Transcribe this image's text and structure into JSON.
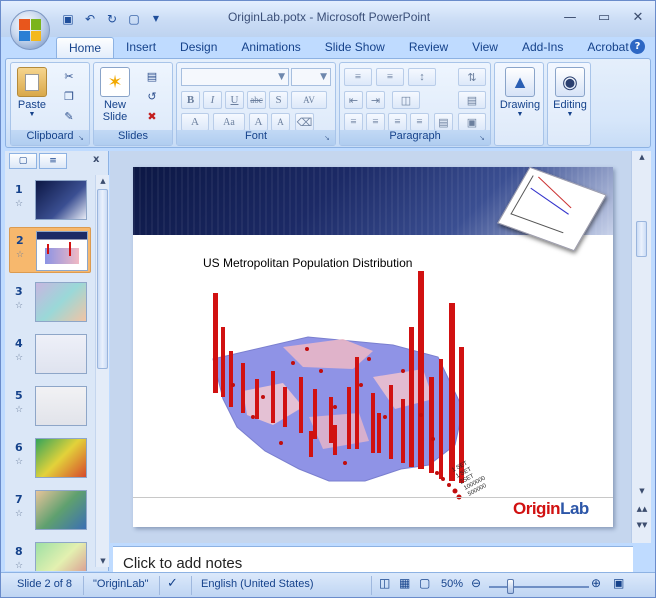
{
  "window": {
    "title": "OriginLab.potx - Microsoft PowerPoint"
  },
  "qat": {
    "items": [
      "save-icon",
      "undo-icon",
      "redo-icon",
      "slide-icon",
      "customize-icon"
    ]
  },
  "tabs": [
    "Home",
    "Insert",
    "Design",
    "Animations",
    "Slide Show",
    "Review",
    "View",
    "Add-Ins",
    "Acrobat"
  ],
  "ribbon": {
    "clipboard": {
      "label": "Clipboard",
      "paste": "Paste"
    },
    "slides": {
      "label": "Slides",
      "new_slide": "New",
      "new_slide2": "Slide"
    },
    "font": {
      "label": "Font"
    },
    "paragraph": {
      "label": "Paragraph"
    },
    "drawing": {
      "label": "Drawing"
    },
    "editing": {
      "label": "Editing"
    }
  },
  "slidepane": {
    "thumbnails": [
      {
        "num": "1"
      },
      {
        "num": "2"
      },
      {
        "num": "3"
      },
      {
        "num": "4"
      },
      {
        "num": "5"
      },
      {
        "num": "6"
      },
      {
        "num": "7"
      },
      {
        "num": "8"
      }
    ]
  },
  "slide": {
    "title": "US Metropolitan Population Distribution",
    "legend": [
      "1 SET",
      "1 SET",
      "2SET",
      "1000000",
      "500000"
    ],
    "brand_origin": "Origin",
    "brand_lab": "Lab"
  },
  "notes": {
    "placeholder": "Click to add notes"
  },
  "status": {
    "slide": "Slide 2 of 8",
    "theme": "\"OriginLab\"",
    "language": "English (United States)",
    "zoom": "50%"
  },
  "colors": {
    "bar_red": "#d11111",
    "map_blue": "#6470d8",
    "map_pink": "#f2b9c2",
    "accent": "#15428b"
  }
}
